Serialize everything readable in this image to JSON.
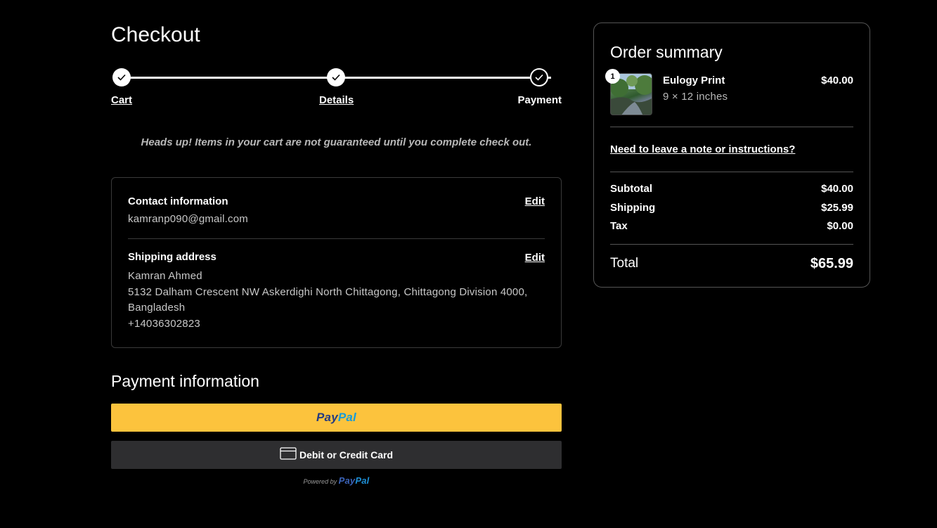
{
  "page_title": "Checkout",
  "stepper": {
    "steps": [
      {
        "label": "Cart",
        "state": "done"
      },
      {
        "label": "Details",
        "state": "done"
      },
      {
        "label": "Payment",
        "state": "current"
      }
    ]
  },
  "notice": "Heads up! Items in your cart are not guaranteed until you complete check out.",
  "contact": {
    "heading": "Contact information",
    "edit_label": "Edit",
    "email": "kamranp090@gmail.com"
  },
  "shipping": {
    "heading": "Shipping address",
    "edit_label": "Edit",
    "name": "Kamran Ahmed",
    "address_line": "5132 Dalham Crescent NW Askerdighi North Chittagong, Chittagong Division 4000,",
    "country": "Bangladesh",
    "phone": "+14036302823"
  },
  "payment": {
    "title": "Payment information",
    "paypal_pay": "Pay",
    "paypal_pal": "Pal",
    "card_button_label": "Debit or Credit Card",
    "powered_by": "Powered by",
    "paypal_button_color": "#fcc33d",
    "card_button_color": "#2e2e30"
  },
  "summary": {
    "title": "Order summary",
    "item": {
      "quantity": "1",
      "name": "Eulogy Print",
      "variant": "9 × 12 inches",
      "price": "$40.00"
    },
    "note_link": "Need to leave a note or instructions?",
    "subtotal_label": "Subtotal",
    "subtotal_value": "$40.00",
    "shipping_label": "Shipping",
    "shipping_value": "$25.99",
    "tax_label": "Tax",
    "tax_value": "$0.00",
    "total_label": "Total",
    "total_value": "$65.99"
  }
}
